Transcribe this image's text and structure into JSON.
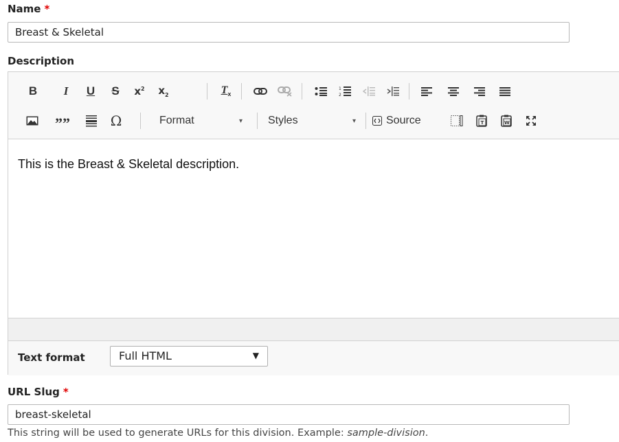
{
  "name_field": {
    "label": "Name",
    "required_mark": "*",
    "value": "Breast & Skeletal"
  },
  "description": {
    "label": "Description",
    "toolbar": {
      "row1": [
        "bold-icon",
        "italic-icon",
        "underline-icon",
        "strikethrough-icon",
        "superscript-icon",
        "subscript-icon",
        "remove-format-icon",
        "link-icon",
        "unlink-icon",
        "bulleted-list-icon",
        "numbered-list-icon",
        "outdent-icon",
        "indent-icon",
        "align-left-icon",
        "align-center-icon",
        "align-right-icon",
        "justify-icon"
      ],
      "row2": [
        "image-icon",
        "blockquote-icon",
        "horizontal-rule-icon",
        "special-character-icon"
      ],
      "format_label": "Format",
      "styles_label": "Styles",
      "source_label": "Source"
    },
    "content": "This is the Breast & Skeletal description.",
    "text_format": {
      "label": "Text format",
      "selected": "Full HTML"
    }
  },
  "url_slug": {
    "label": "URL Slug",
    "required_mark": "*",
    "value": "breast-skeletal",
    "help_prefix": "This string will be used to generate URLs for this division. Example: ",
    "help_example": "sample-division",
    "help_suffix": "."
  }
}
